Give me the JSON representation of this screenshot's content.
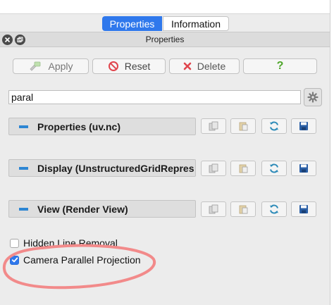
{
  "tabs": [
    {
      "label": "Properties",
      "active": true
    },
    {
      "label": "Information",
      "active": false
    }
  ],
  "panel": {
    "title": "Properties"
  },
  "actions": {
    "apply_label": "Apply",
    "reset_label": "Reset",
    "delete_label": "Delete",
    "help_label": "?"
  },
  "search": {
    "value": "paral"
  },
  "sections": [
    {
      "label": "Properties (uv.nc)"
    },
    {
      "label": "Display (UnstructuredGridRepres"
    },
    {
      "label": "View (Render View)"
    }
  ],
  "options": {
    "hidden_line_removal": {
      "label": "Hidden Line Removal",
      "checked": false
    },
    "camera_parallel_projection": {
      "label": "Camera Parallel Projection",
      "checked": true
    }
  },
  "colors": {
    "accent": "#2f78ec",
    "section_marker": "#2d86d3",
    "annotation_circle": "#f28a8a",
    "help_icon": "#4fa62b",
    "delete_icon": "#e0454d"
  }
}
